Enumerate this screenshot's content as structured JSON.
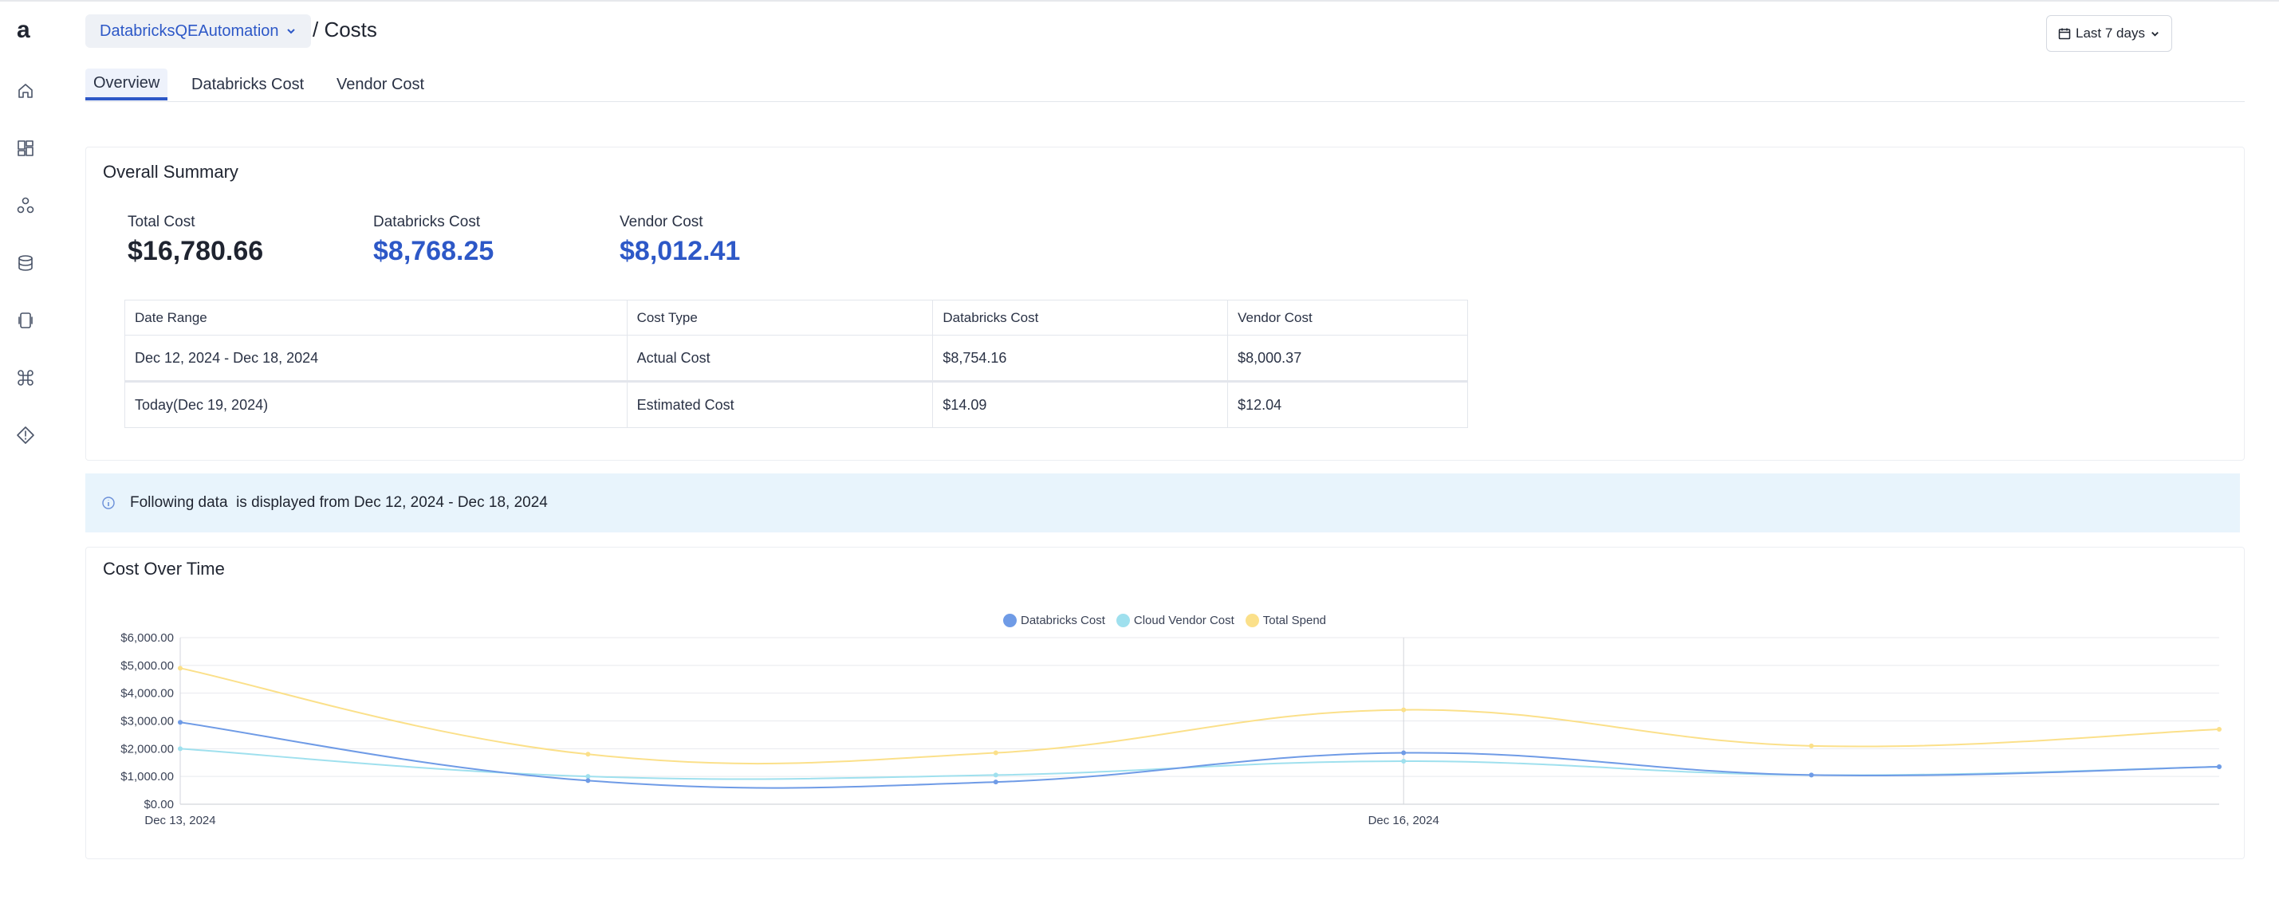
{
  "header": {
    "workspace": "DatabricksQEAutomation",
    "breadcrumb": "/  Costs",
    "date_range_button": "Last 7 days"
  },
  "sidebar": {
    "logo": "a",
    "items": [
      "home-icon",
      "dashboard-icon",
      "clusters-icon",
      "database-icon",
      "device-icon",
      "command-icon",
      "alert-icon"
    ]
  },
  "tabs": [
    {
      "label": "Overview",
      "active": true
    },
    {
      "label": "Databricks Cost",
      "active": false
    },
    {
      "label": "Vendor Cost",
      "active": false
    }
  ],
  "summary": {
    "title": "Overall Summary",
    "kpis": [
      {
        "label": "Total Cost",
        "value": "$16,780.66",
        "color": "#1f2430"
      },
      {
        "label": "Databricks Cost",
        "value": "$8,768.25",
        "color": "#2d58c7"
      },
      {
        "label": "Vendor Cost",
        "value": "$8,012.41",
        "color": "#2d58c7"
      }
    ],
    "table": {
      "columns": [
        "Date Range",
        "Cost Type",
        "Databricks Cost",
        "Vendor Cost"
      ],
      "rows": [
        [
          "Dec 12, 2024 - Dec 18, 2024",
          "Actual Cost",
          "$8,754.16",
          "$8,000.37"
        ],
        [
          "Today(Dec 19, 2024)",
          "Estimated Cost",
          "$14.09",
          "$12.04"
        ]
      ]
    }
  },
  "info_banner": "Following data  is displayed from Dec 12, 2024 - Dec 18, 2024",
  "chart": {
    "title": "Cost Over Time",
    "colors": {
      "Databricks Cost": "#6f9be6",
      "Cloud Vendor Cost": "#9fe0ee",
      "Total Spend": "#fbe08a"
    }
  },
  "chart_data": {
    "type": "line",
    "title": "Cost Over Time",
    "x": [
      "Dec 13, 2024",
      "Dec 14, 2024",
      "Dec 15, 2024",
      "Dec 16, 2024",
      "Dec 17, 2024",
      "Dec 18, 2024"
    ],
    "x_tick_labels": [
      "Dec 13, 2024",
      "Dec 16, 2024"
    ],
    "ylim": [
      0,
      6000
    ],
    "y_tick_labels": [
      "$0.00",
      "$1,000.00",
      "$2,000.00",
      "$3,000.00",
      "$4,000.00",
      "$5,000.00",
      "$6,000.00"
    ],
    "legend_position": "top-center",
    "grid": true,
    "series": [
      {
        "name": "Databricks Cost",
        "values": [
          2950,
          850,
          800,
          1850,
          1050,
          1350
        ]
      },
      {
        "name": "Cloud Vendor Cost",
        "values": [
          2000,
          1000,
          1050,
          1550,
          1050,
          1350
        ]
      },
      {
        "name": "Total Spend",
        "values": [
          4900,
          1800,
          1850,
          3400,
          2100,
          2700
        ]
      }
    ]
  }
}
